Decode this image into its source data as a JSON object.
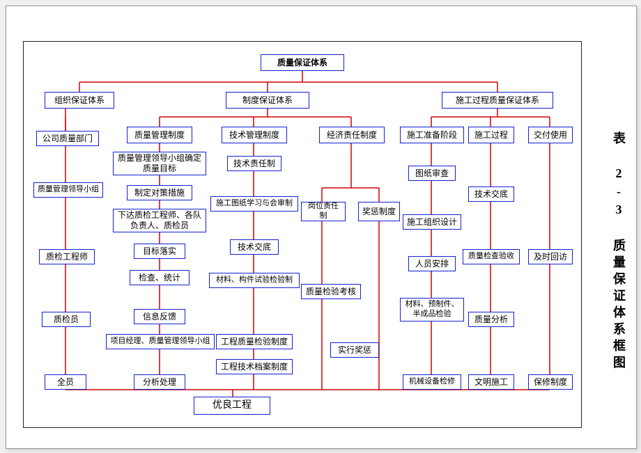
{
  "sidebar_title": "表 2-3  质量保证体系框图",
  "root": "质量保证体系",
  "level1": {
    "org": "组织保证体系",
    "sys": "制度保证体系",
    "proc": "施工过程质量保证体系"
  },
  "col1": {
    "a": "公司质量部门",
    "b": "质量管理领导小组",
    "c": "质检工程师",
    "d": "质检员",
    "e": "全员"
  },
  "col2": {
    "head": "质量管理制度",
    "a": "质量管理领导小组确定质量目标",
    "b": "制定对策措施",
    "c": "下达质检工程师、各队负责人、质检员",
    "d": "目标落实",
    "e": "检查、统计",
    "f": "信息反馈",
    "g": "项目经理、质量管理领导小组",
    "h": "分析处理"
  },
  "col3": {
    "head": "技术管理制度",
    "a": "技术责任制",
    "b": "施工图纸学习与会审制",
    "c": "技术交底",
    "d": "材料、构件试验检验制",
    "e": "工程质量检验制度",
    "f": "工程技术档案制度"
  },
  "col4": {
    "head": "经济责任制度",
    "a": "岗位责任制",
    "b": "奖惩制度",
    "c": "质量检验考核",
    "d": "实行奖惩"
  },
  "col5": {
    "head": "施工准备阶段",
    "a": "图纸审查",
    "b": "施工组织设计",
    "c": "人员安排",
    "d": "材料、预制件、半成品检验",
    "e": "机械设备检修"
  },
  "col6": {
    "head": "施工过程",
    "a": "技术交底",
    "b": "质量检查验收",
    "c": "质量分析",
    "d": "文明施工"
  },
  "col7": {
    "head": "交付使用",
    "a": "及时回访",
    "b": "保修制度"
  },
  "bottom": "优良工程"
}
